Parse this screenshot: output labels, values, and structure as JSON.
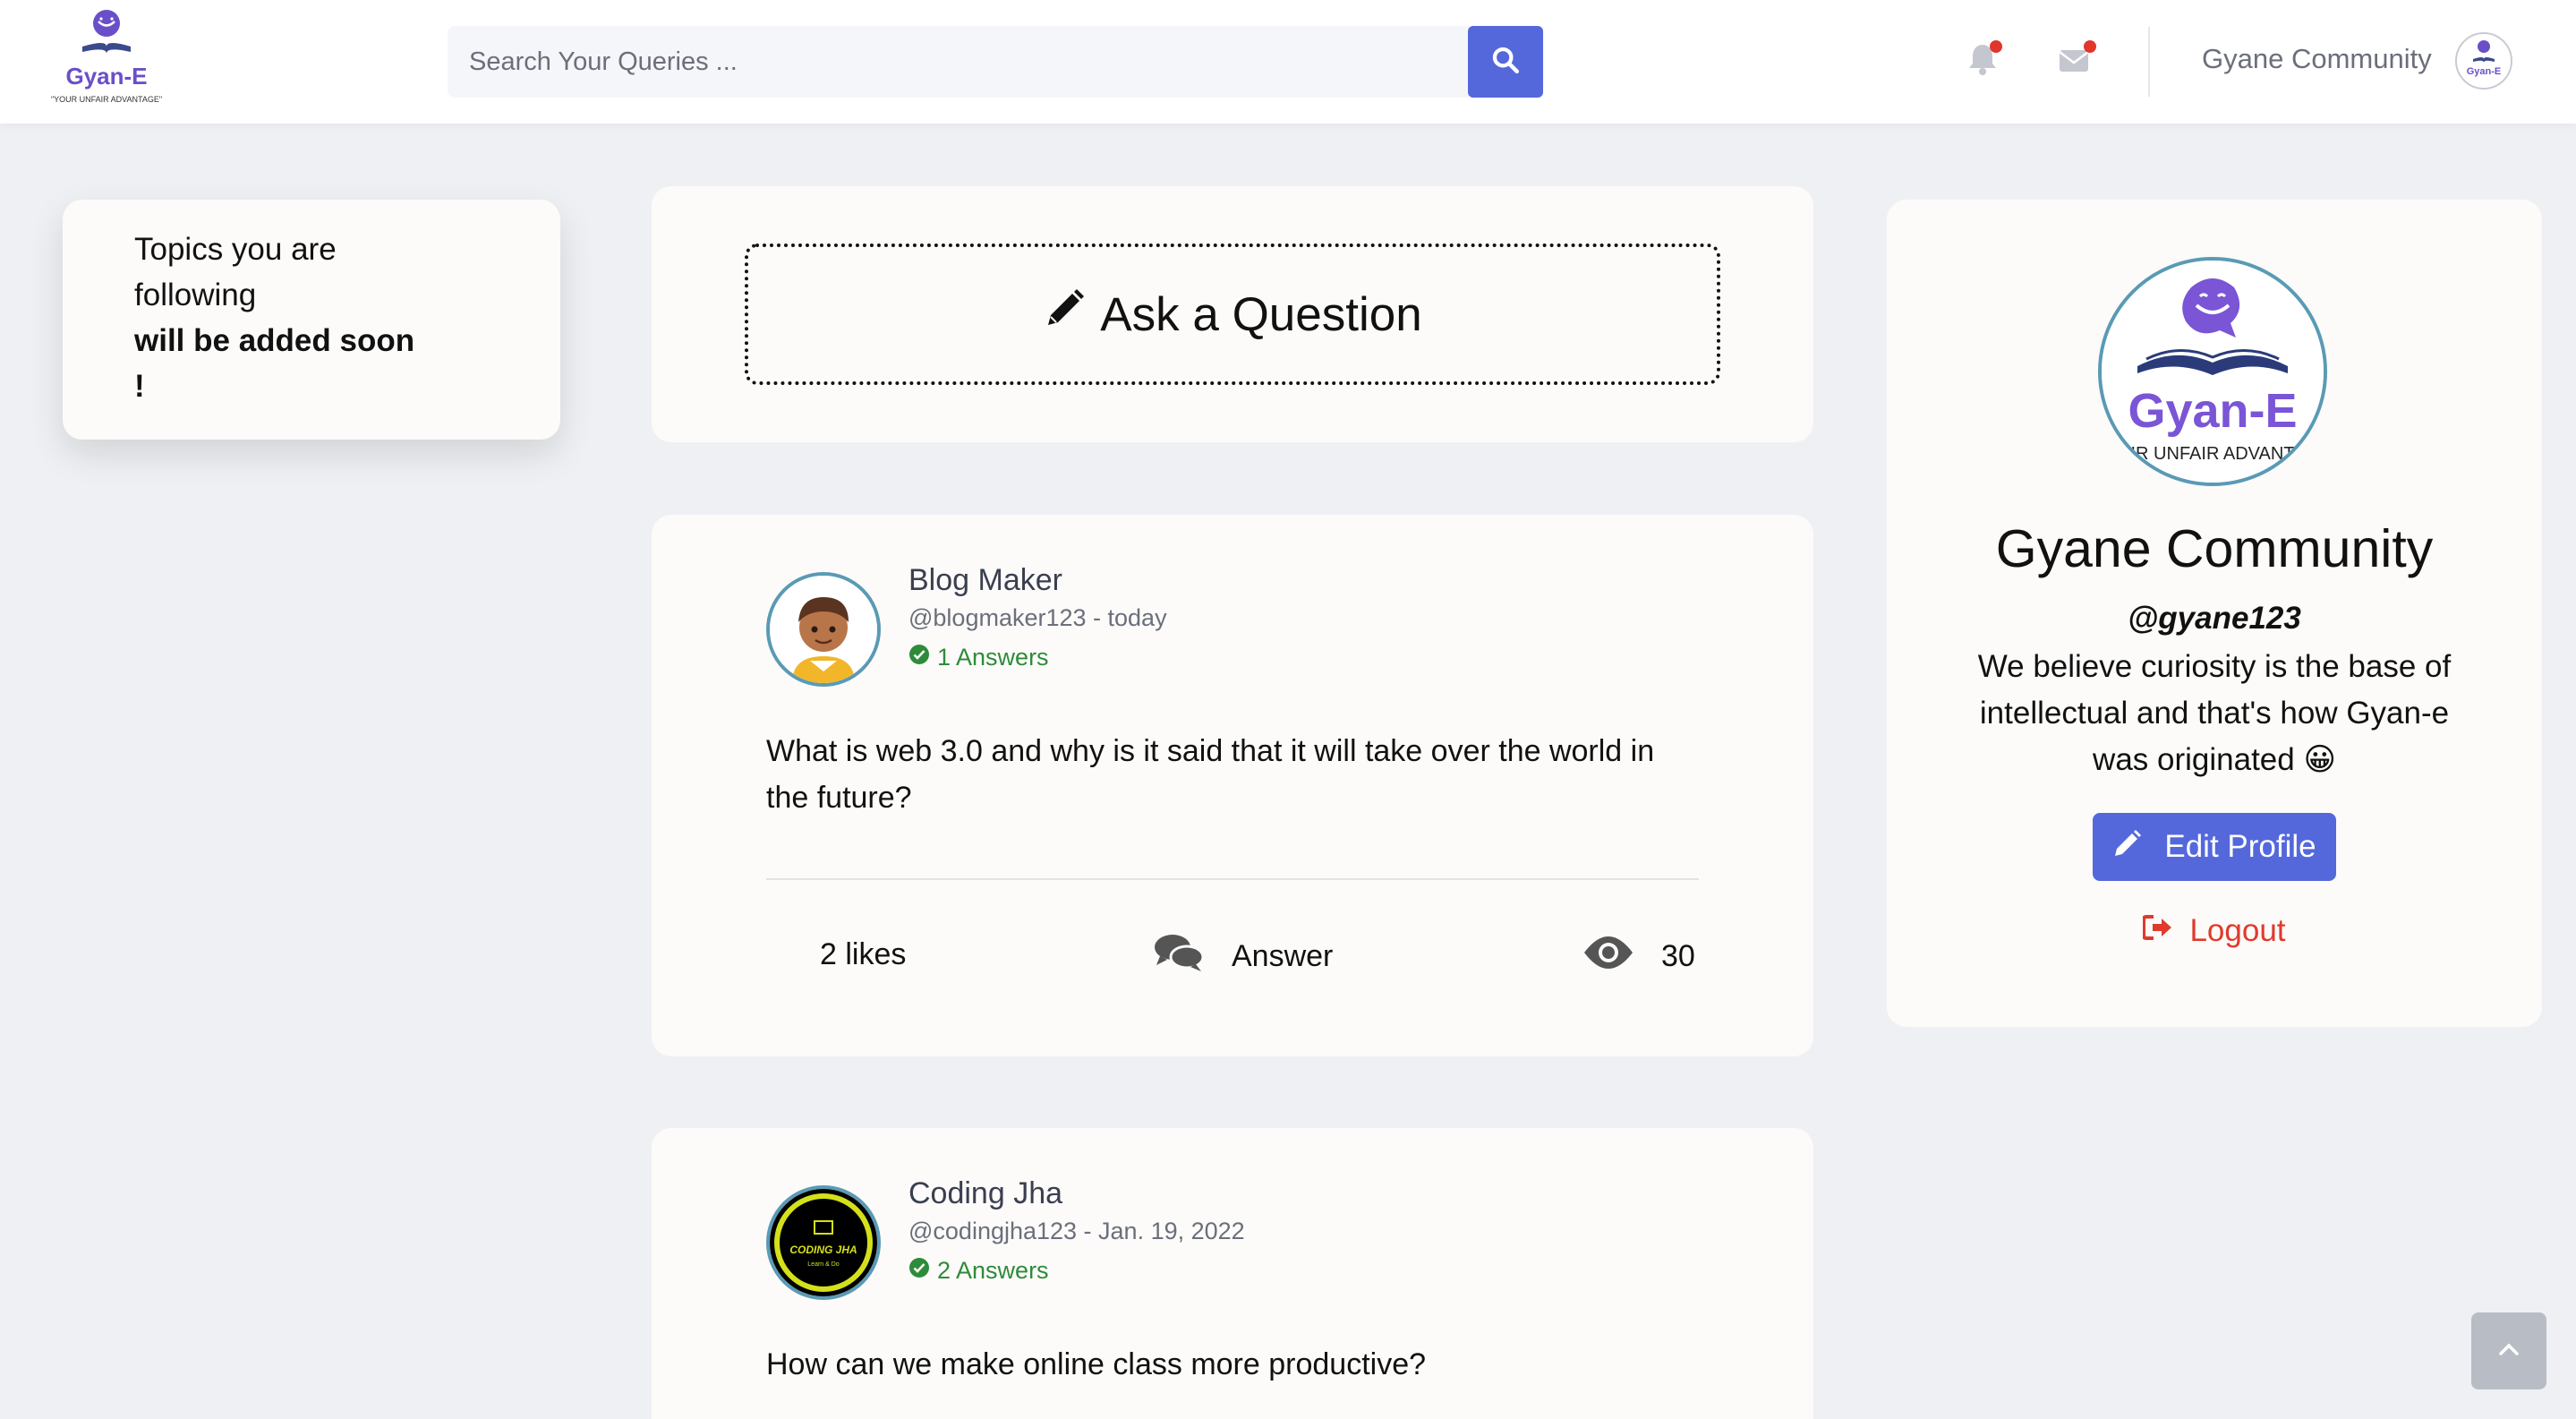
{
  "header": {
    "logo_text": "Gyan-E",
    "logo_tagline": "\"YOUR UNFAIR ADVANTAGE\"",
    "search_placeholder": "Search Your Queries ...",
    "user_name": "Gyane Community"
  },
  "topics": {
    "line1": "Topics you are",
    "line2": "following",
    "line3": "will be added soon",
    "line4": "!"
  },
  "ask": {
    "label": "Ask a Question"
  },
  "posts": [
    {
      "author": "Blog Maker",
      "meta": "@blogmaker123 - today",
      "answers": "1 Answers",
      "question": "What is web 3.0 and why is it said that it will take over the world in the future?",
      "likes": "2 likes",
      "answer_label": "Answer",
      "views": "30"
    },
    {
      "author": "Coding Jha",
      "meta": "@codingjha123 - Jan. 19, 2022",
      "answers": "2 Answers",
      "question": "How can we make online class more productive?",
      "avatar_text": "CODING JHA",
      "avatar_sub": "Learn & Do"
    }
  ],
  "profile": {
    "name": "Gyane Community",
    "handle": "@gyane123",
    "bio": "We believe curiosity is the base of intellectual and that's how Gyan-e was originated 😀",
    "logo_text": "Gyan-E",
    "logo_tagline": "IR UNFAIR ADVANT",
    "edit_label": "Edit Profile",
    "logout_label": "Logout"
  },
  "colors": {
    "primary": "#5468dc",
    "success": "#2e8b3a",
    "danger": "#e03a2c",
    "background": "#eef0f4",
    "logo_purple": "#6a4fc9"
  },
  "icons": [
    "search-icon",
    "bell-icon",
    "envelope-icon",
    "pencil-icon",
    "check-circle-icon",
    "comments-icon",
    "eye-icon",
    "sign-out-icon",
    "chevron-up-icon"
  ]
}
